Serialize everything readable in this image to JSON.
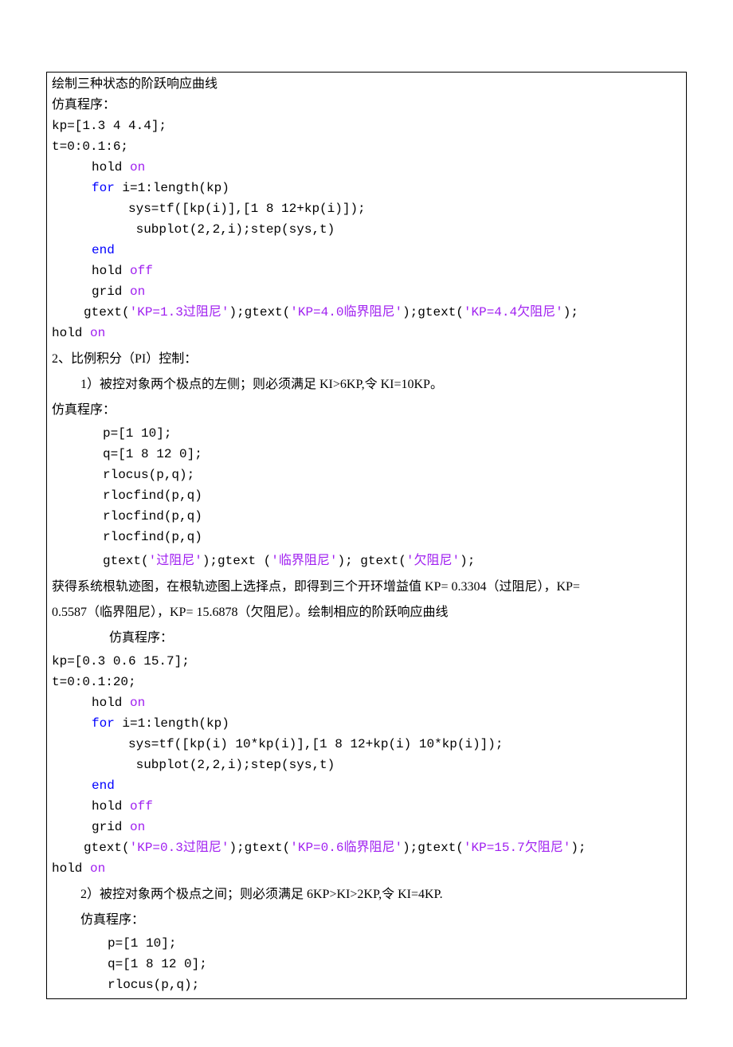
{
  "l1": "绘制三种状态的阶跃响应曲线",
  "l2": "仿真程序：",
  "l3": "kp=[1.3 4 4.4];",
  "l4": "t=0:0.1:6;",
  "l5a": "hold",
  "l5b": " on",
  "l6a": "for",
  "l6b": " i=1:length(kp)",
  "l7": "sys=tf([kp(i)],[1 8 12+kp(i)]);",
  "l8": " subplot(2,2,i);step(sys,t)",
  "l9": "end",
  "l10a": "hold ",
  "l10b": "off",
  "l11a": "grid ",
  "l11b": "on",
  "l12a": "gtext(",
  "l12s1": "'KP=1.3过阻尼'",
  "l12b": ");gtext(",
  "l12s2": "'KP=4.0临界阻尼'",
  "l12c": ");gtext(",
  "l12s3": "'KP=4.4欠阻尼'",
  "l12d": ");",
  "l13a": "hold ",
  "l13b": "on",
  "p1": "2、比例积分（PI）控制：",
  "p2": "1）被控对象两个极点的左侧；则必须满足 KI>6KP,令 KI=10KP。",
  "p3": "仿真程序：",
  "c2_1": "p=[1 10];",
  "c2_2": "q=[1 8 12 0];",
  "c2_3": "rlocus(p,q);",
  "c2_4": "rlocfind(p,q)",
  "c2_5": "rlocfind(p,q)",
  "c2_6": "rlocfind(p,q)",
  "c2_7a": "gtext(",
  "c2_7s1": "'过阻尼'",
  "c2_7b": ");gtext (",
  "c2_7s2": "'临界阻尼'",
  "c2_7c": "); gtext(",
  "c2_7s3": "'欠阻尼'",
  "c2_7d": ");",
  "p4": "获得系统根轨迹图，在根轨迹图上选择点，即得到三个开环增益值 KP= 0.3304（过阻尼），KP=",
  "p5": "0.5587（临界阻尼），KP= 15.6878（欠阻尼）。绘制相应的阶跃响应曲线",
  "p6": "仿真程序：",
  "c3_1": "kp=[0.3 0.6 15.7];",
  "c3_2": "t=0:0.1:20;",
  "c3_3a": "hold",
  "c3_3b": " on",
  "c3_4a": "for",
  "c3_4b": " i=1:length(kp)",
  "c3_5": "sys=tf([kp(i) 10*kp(i)],[1 8 12+kp(i) 10*kp(i)]);",
  "c3_6": " subplot(2,2,i);step(sys,t)",
  "c3_7": "end",
  "c3_8a": "hold ",
  "c3_8b": "off",
  "c3_9a": "grid ",
  "c3_9b": "on",
  "c3_10a": "gtext(",
  "c3_10s1": "'KP=0.3过阻尼'",
  "c3_10b": ");gtext(",
  "c3_10s2": "'KP=0.6临界阻尼'",
  "c3_10c": ");gtext(",
  "c3_10s3": "'KP=15.7欠阻尼'",
  "c3_10d": ");",
  "c3_11a": "hold ",
  "c3_11b": "on",
  "p7": "2）被控对象两个极点之间；则必须满足 6KP>KI>2KP,令 KI=4KP.",
  "p8": "仿真程序：",
  "c4_1": "p=[1 10];",
  "c4_2": "q=[1 8 12 0];",
  "c4_3": "rlocus(p,q);"
}
